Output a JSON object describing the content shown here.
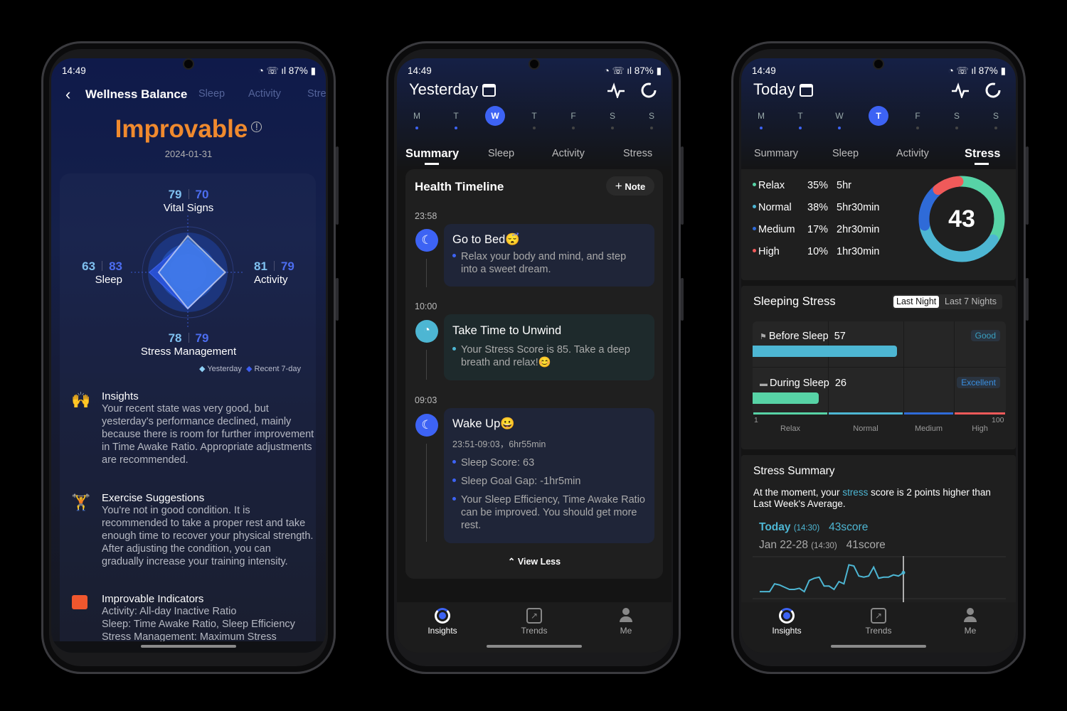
{
  "status": {
    "time": "14:49",
    "battery": "87%"
  },
  "phone1": {
    "title": "Wellness Balance",
    "tabs": [
      "Sleep",
      "Activity",
      "Stre"
    ],
    "rating": "Improvable",
    "rating_color": "#f08a2e",
    "date": "2024-01-31",
    "radar": {
      "axes": [
        {
          "label": "Vital Signs",
          "yesterday": 79,
          "recent": 70
        },
        {
          "label": "Activity",
          "yesterday": 81,
          "recent": 79
        },
        {
          "label": "Stress Management",
          "yesterday": 78,
          "recent": 79
        },
        {
          "label": "Sleep",
          "yesterday": 63,
          "recent": 83
        }
      ],
      "legend": {
        "yesterday": "Yesterday",
        "recent": "Recent 7-day"
      },
      "max": 100
    },
    "insights": [
      {
        "icon": "person-cheer-icon",
        "title": "Insights",
        "body": "Your recent state was very good, but yesterday's performance declined, mainly because there is room for further improvement in Time Awake Ratio. Appropriate adjustments are recommended."
      },
      {
        "icon": "dumbbell-icon",
        "title": "Exercise Suggestions",
        "body": "You're not in good condition. It is recommended to take a proper rest and take enough time to recover your physical strength. After adjusting the condition, you can gradually increase your training intensity."
      },
      {
        "icon": "alert-card-icon",
        "title": "Improvable Indicators",
        "lines": [
          "Activity: All-day Inactive Ratio",
          "Sleep: Time Awake Ratio, Sleep Efficiency",
          "Stress Management: Maximum Stress"
        ]
      }
    ]
  },
  "days": [
    "M",
    "T",
    "W",
    "T",
    "F",
    "S",
    "S"
  ],
  "tabs": [
    "Summary",
    "Sleep",
    "Activity",
    "Stress"
  ],
  "nav": [
    "Insights",
    "Trends",
    "Me"
  ],
  "phone2": {
    "title": "Yesterday",
    "selected_day": 2,
    "timeline_title": "Health Timeline",
    "note_label": "Note",
    "events": [
      {
        "time": "23:58",
        "title": "Go to Bed😴",
        "bullets": [
          "Relax your body and mind, and step into a sweet dream."
        ]
      },
      {
        "time": "10:00",
        "title": "Take Time to Unwind",
        "bullets": [
          "Your Stress Score is 85. Take a deep breath and relax!😊"
        ]
      },
      {
        "time": "09:03",
        "title": "Wake Up😀",
        "subtitle": "23:51-09:03，6hr55min",
        "bullets": [
          "Sleep Score: 63",
          "Sleep Goal Gap: -1hr5min",
          "Your Sleep Efficiency, Time Awake Ratio can be improved. You should get more rest."
        ]
      }
    ],
    "view_less": "View Less"
  },
  "phone3": {
    "title": "Today",
    "selected_day": 3,
    "stress_score": "43",
    "levels": [
      {
        "name": "Relax",
        "pct": 35,
        "pct_label": "35%",
        "duration": "5hr",
        "color": "#57d3a6"
      },
      {
        "name": "Normal",
        "pct": 38,
        "pct_label": "38%",
        "duration": "5hr30min",
        "color": "#4db6d3"
      },
      {
        "name": "Medium",
        "pct": 17,
        "pct_label": "17%",
        "duration": "2hr30min",
        "color": "#2f6bd8"
      },
      {
        "name": "High",
        "pct": 10,
        "pct_label": "10%",
        "duration": "1hr30min",
        "color": "#f05a5a"
      }
    ],
    "sleeping_stress": {
      "title": "Sleeping Stress",
      "toggle": [
        "Last Night",
        "Last 7 Nights"
      ],
      "rows": [
        {
          "label": "Before Sleep",
          "value": 57,
          "value_label": "57",
          "tag": "Good",
          "color": "#4db6d3",
          "tag_color": "#3aa0c0"
        },
        {
          "label": "During Sleep",
          "value": 26,
          "value_label": "26",
          "tag": "Excellent",
          "color": "#57d3a6",
          "tag_color": "#3a8fe0"
        }
      ],
      "scale_min": "1",
      "scale_max": "100",
      "zones": [
        "Relax",
        "Normal",
        "Medium",
        "High"
      ]
    },
    "summary": {
      "title": "Stress Summary",
      "text_before": "At the moment, your ",
      "text_link": "stress",
      "text_after": " score is 2 points higher than Last Week's Average.",
      "today_label": "Today",
      "today_time": "(14:30)",
      "today_score": "43score",
      "week_label": "Jan 22-28",
      "week_time": "(14:30)",
      "week_score": "41score",
      "trend": [
        30,
        30,
        30,
        37,
        36,
        34,
        32,
        32,
        33,
        30,
        40,
        42,
        43,
        35,
        35,
        32,
        39,
        37,
        54,
        53,
        44,
        43,
        44,
        52,
        42,
        43,
        43,
        45,
        44,
        47
      ]
    }
  }
}
